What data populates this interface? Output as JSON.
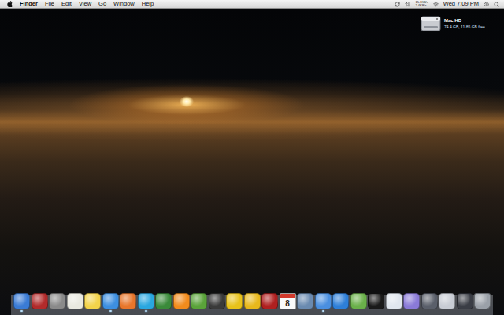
{
  "menu_bar": {
    "app": "Finder",
    "menus": [
      "File",
      "Edit",
      "View",
      "Go",
      "Window",
      "Help"
    ],
    "network": [
      "15.1KB/s",
      "2.4KB/s"
    ],
    "clock": "Wed 7:09 PM"
  },
  "desktop_icons": [
    {
      "name": "Mac HD",
      "info": "74.4 GB, 11.85 GB free",
      "selected": false
    }
  ],
  "dock": {
    "items": [
      {
        "kind": "app",
        "color": "#3a7bd5",
        "running": true
      },
      {
        "kind": "app",
        "color": "#b22b2b",
        "running": false
      },
      {
        "kind": "app",
        "color": "#8a8a8a",
        "running": false
      },
      {
        "kind": "app",
        "color": "#e8e8e0",
        "running": false
      },
      {
        "kind": "app",
        "color": "#f3d34a",
        "running": false
      },
      {
        "kind": "app",
        "color": "#3d8fe0",
        "running": true
      },
      {
        "kind": "app",
        "color": "#e8762b",
        "running": false
      },
      {
        "kind": "app",
        "color": "#2aa7e0",
        "running": true
      },
      {
        "kind": "app",
        "color": "#3a8a3a",
        "running": false
      },
      {
        "kind": "app",
        "color": "#f28b1c",
        "running": false
      },
      {
        "kind": "app",
        "color": "#5aa33a",
        "running": false
      },
      {
        "kind": "app",
        "color": "#3a3a3a",
        "running": false
      },
      {
        "kind": "app",
        "color": "#e8c21a",
        "running": false
      },
      {
        "kind": "app",
        "color": "#e8b81c",
        "running": false
      },
      {
        "kind": "app",
        "color": "#b02020",
        "running": false
      },
      {
        "kind": "calendar",
        "text": "8",
        "color": "#d33a2c",
        "running": false
      },
      {
        "kind": "app",
        "color": "#6a8ab0",
        "running": false
      },
      {
        "kind": "app",
        "color": "#4a8fe0",
        "running": true
      },
      {
        "kind": "app",
        "color": "#2e7fd9",
        "running": false
      },
      {
        "kind": "app",
        "color": "#6ab04a",
        "running": false
      },
      {
        "kind": "app",
        "color": "#1a1a1a",
        "running": false
      },
      {
        "kind": "app",
        "color": "#e0e6ee",
        "running": false
      },
      {
        "kind": "app",
        "color": "#8a7ad8",
        "running": false
      },
      {
        "kind": "app",
        "color": "#5a5f6a",
        "running": false
      },
      {
        "kind": "app",
        "color": "#c8ccd4",
        "running": false
      },
      {
        "kind": "app",
        "color": "#3a3d45",
        "running": false
      },
      {
        "kind": "trash",
        "color": "#9aa0a8",
        "running": false
      }
    ]
  }
}
